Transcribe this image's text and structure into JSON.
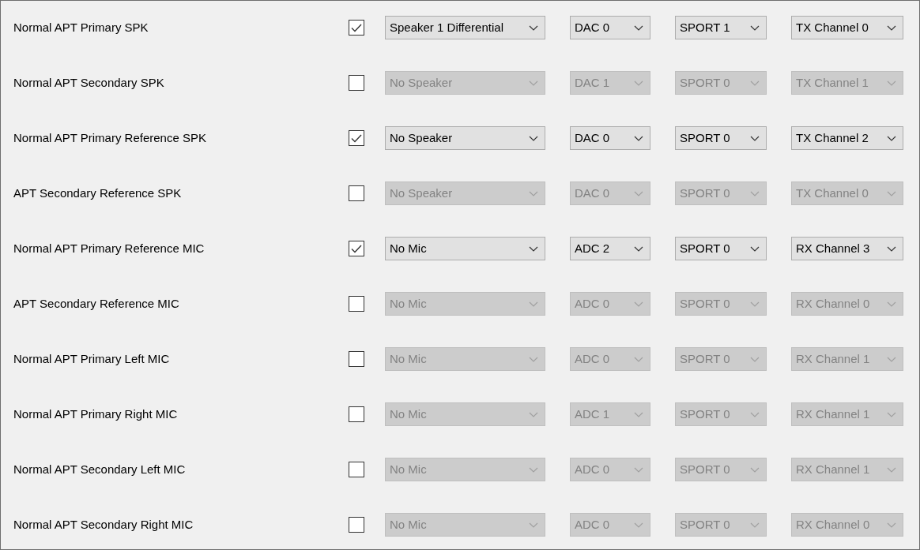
{
  "rows": [
    {
      "label": "Normal APT Primary SPK",
      "checked": true,
      "selects": [
        {
          "value": "Speaker 1 Differential",
          "disabled": false
        },
        {
          "value": "DAC 0",
          "disabled": false
        },
        {
          "value": "SPORT 1",
          "disabled": false
        },
        {
          "value": "TX Channel 0",
          "disabled": false
        }
      ]
    },
    {
      "label": "Normal APT Secondary SPK",
      "checked": false,
      "selects": [
        {
          "value": "No Speaker",
          "disabled": true
        },
        {
          "value": "DAC 1",
          "disabled": true
        },
        {
          "value": "SPORT 0",
          "disabled": true
        },
        {
          "value": "TX Channel 1",
          "disabled": true
        }
      ]
    },
    {
      "label": "Normal APT Primary Reference SPK",
      "checked": true,
      "selects": [
        {
          "value": "No Speaker",
          "disabled": false
        },
        {
          "value": "DAC 0",
          "disabled": false
        },
        {
          "value": "SPORT 0",
          "disabled": false
        },
        {
          "value": "TX Channel 2",
          "disabled": false
        }
      ]
    },
    {
      "label": "APT Secondary Reference SPK",
      "checked": false,
      "selects": [
        {
          "value": "No Speaker",
          "disabled": true
        },
        {
          "value": "DAC 0",
          "disabled": true
        },
        {
          "value": "SPORT 0",
          "disabled": true
        },
        {
          "value": "TX Channel 0",
          "disabled": true
        }
      ]
    },
    {
      "label": "Normal APT Primary Reference MIC",
      "checked": true,
      "selects": [
        {
          "value": "No Mic",
          "disabled": false
        },
        {
          "value": "ADC 2",
          "disabled": false
        },
        {
          "value": "SPORT 0",
          "disabled": false
        },
        {
          "value": "RX Channel 3",
          "disabled": false
        }
      ]
    },
    {
      "label": "APT Secondary Reference MIC",
      "checked": false,
      "selects": [
        {
          "value": "No Mic",
          "disabled": true
        },
        {
          "value": "ADC 0",
          "disabled": true
        },
        {
          "value": "SPORT 0",
          "disabled": true
        },
        {
          "value": "RX Channel 0",
          "disabled": true
        }
      ]
    },
    {
      "label": "Normal APT Primary Left MIC",
      "checked": false,
      "selects": [
        {
          "value": "No Mic",
          "disabled": true
        },
        {
          "value": "ADC 0",
          "disabled": true
        },
        {
          "value": "SPORT 0",
          "disabled": true
        },
        {
          "value": "RX Channel 1",
          "disabled": true
        }
      ]
    },
    {
      "label": "Normal APT Primary Right MIC",
      "checked": false,
      "selects": [
        {
          "value": "No Mic",
          "disabled": true
        },
        {
          "value": "ADC 1",
          "disabled": true
        },
        {
          "value": "SPORT 0",
          "disabled": true
        },
        {
          "value": "RX Channel 1",
          "disabled": true
        }
      ]
    },
    {
      "label": "Normal APT Secondary Left MIC",
      "checked": false,
      "selects": [
        {
          "value": "No Mic",
          "disabled": true
        },
        {
          "value": "ADC 0",
          "disabled": true
        },
        {
          "value": "SPORT 0",
          "disabled": true
        },
        {
          "value": "RX Channel 1",
          "disabled": true
        }
      ]
    },
    {
      "label": "Normal APT Secondary Right MIC",
      "checked": false,
      "selects": [
        {
          "value": "No Mic",
          "disabled": true
        },
        {
          "value": "ADC 0",
          "disabled": true
        },
        {
          "value": "SPORT 0",
          "disabled": true
        },
        {
          "value": "RX Channel 0",
          "disabled": true
        }
      ]
    }
  ]
}
